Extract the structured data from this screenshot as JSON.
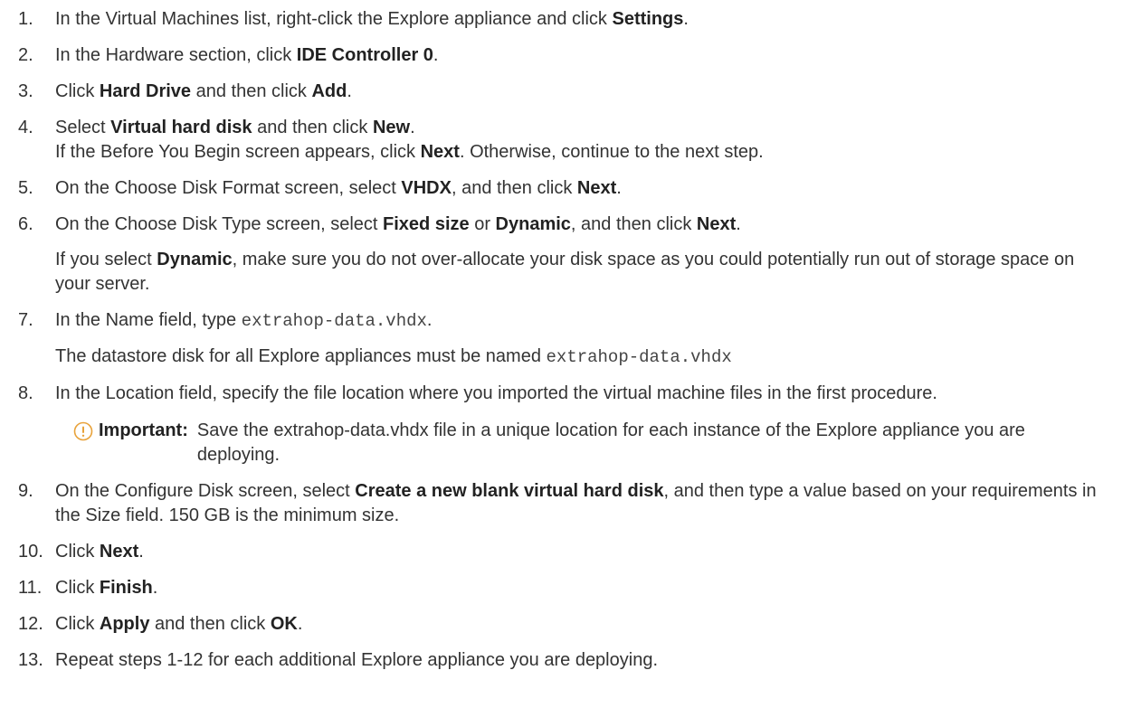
{
  "steps": [
    {
      "number": "1.",
      "parts": [
        {
          "t": "In the Virtual Machines list, right-click the Explore appliance and click "
        },
        {
          "b": "Settings"
        },
        {
          "t": "."
        }
      ]
    },
    {
      "number": "2.",
      "parts": [
        {
          "t": "In the Hardware section, click "
        },
        {
          "b": "IDE Controller 0"
        },
        {
          "t": "."
        }
      ]
    },
    {
      "number": "3.",
      "parts": [
        {
          "t": "Click "
        },
        {
          "b": "Hard Drive"
        },
        {
          "t": " and then click "
        },
        {
          "b": "Add"
        },
        {
          "t": "."
        }
      ]
    },
    {
      "number": "4.",
      "parts": [
        {
          "t": "Select "
        },
        {
          "b": "Virtual hard disk"
        },
        {
          "t": " and then click "
        },
        {
          "b": "New"
        },
        {
          "t": "."
        }
      ],
      "extra": [
        {
          "gap": false,
          "parts": [
            {
              "t": "If the Before You Begin screen appears, click "
            },
            {
              "b": "Next"
            },
            {
              "t": ". Otherwise, continue to the next step."
            }
          ]
        }
      ]
    },
    {
      "number": "5.",
      "parts": [
        {
          "t": "On the Choose Disk Format screen, select "
        },
        {
          "b": "VHDX"
        },
        {
          "t": ", and then click "
        },
        {
          "b": "Next"
        },
        {
          "t": "."
        }
      ]
    },
    {
      "number": "6.",
      "parts": [
        {
          "t": "On the Choose Disk Type screen, select "
        },
        {
          "b": "Fixed size"
        },
        {
          "t": " or "
        },
        {
          "b": "Dynamic"
        },
        {
          "t": ", and then click "
        },
        {
          "b": "Next"
        },
        {
          "t": "."
        }
      ],
      "extra": [
        {
          "gap": true,
          "parts": [
            {
              "t": "If you select "
            },
            {
              "b": "Dynamic"
            },
            {
              "t": ", make sure you do not over-allocate your disk space as you could potentially run out of storage space on your server."
            }
          ]
        }
      ]
    },
    {
      "number": "7.",
      "parts": [
        {
          "t": "In the Name field, type "
        },
        {
          "c": "extrahop-data.vhdx"
        },
        {
          "t": "."
        }
      ],
      "extra": [
        {
          "gap": true,
          "parts": [
            {
              "t": "The datastore disk for all Explore appliances must be named "
            },
            {
              "c": "extrahop-data.vhdx"
            }
          ]
        }
      ]
    },
    {
      "number": "8.",
      "parts": [
        {
          "t": "In the Location field, specify the file location where you imported the virtual machine files in the first procedure."
        }
      ],
      "note": {
        "icon": "important-icon",
        "label": "Important:",
        "text": "Save the extrahop-data.vhdx file in a unique location for each instance of the Explore appliance you are deploying."
      }
    },
    {
      "number": "9.",
      "parts": [
        {
          "t": "On the Configure Disk screen, select "
        },
        {
          "b": "Create a new blank virtual hard disk"
        },
        {
          "t": ", and then type a value based on your requirements in the Size field. 150 GB is the minimum size."
        }
      ]
    },
    {
      "number": "10.",
      "parts": [
        {
          "t": "Click "
        },
        {
          "b": "Next"
        },
        {
          "t": "."
        }
      ]
    },
    {
      "number": "11.",
      "parts": [
        {
          "t": "Click "
        },
        {
          "b": "Finish"
        },
        {
          "t": "."
        }
      ]
    },
    {
      "number": "12.",
      "parts": [
        {
          "t": "Click "
        },
        {
          "b": "Apply"
        },
        {
          "t": " and then click "
        },
        {
          "b": "OK"
        },
        {
          "t": "."
        }
      ]
    },
    {
      "number": "13.",
      "parts": [
        {
          "t": "Repeat steps 1-12 for each additional Explore appliance you are deploying."
        }
      ]
    }
  ],
  "colors": {
    "text": "#333333",
    "note_icon": "#e8a23a"
  }
}
